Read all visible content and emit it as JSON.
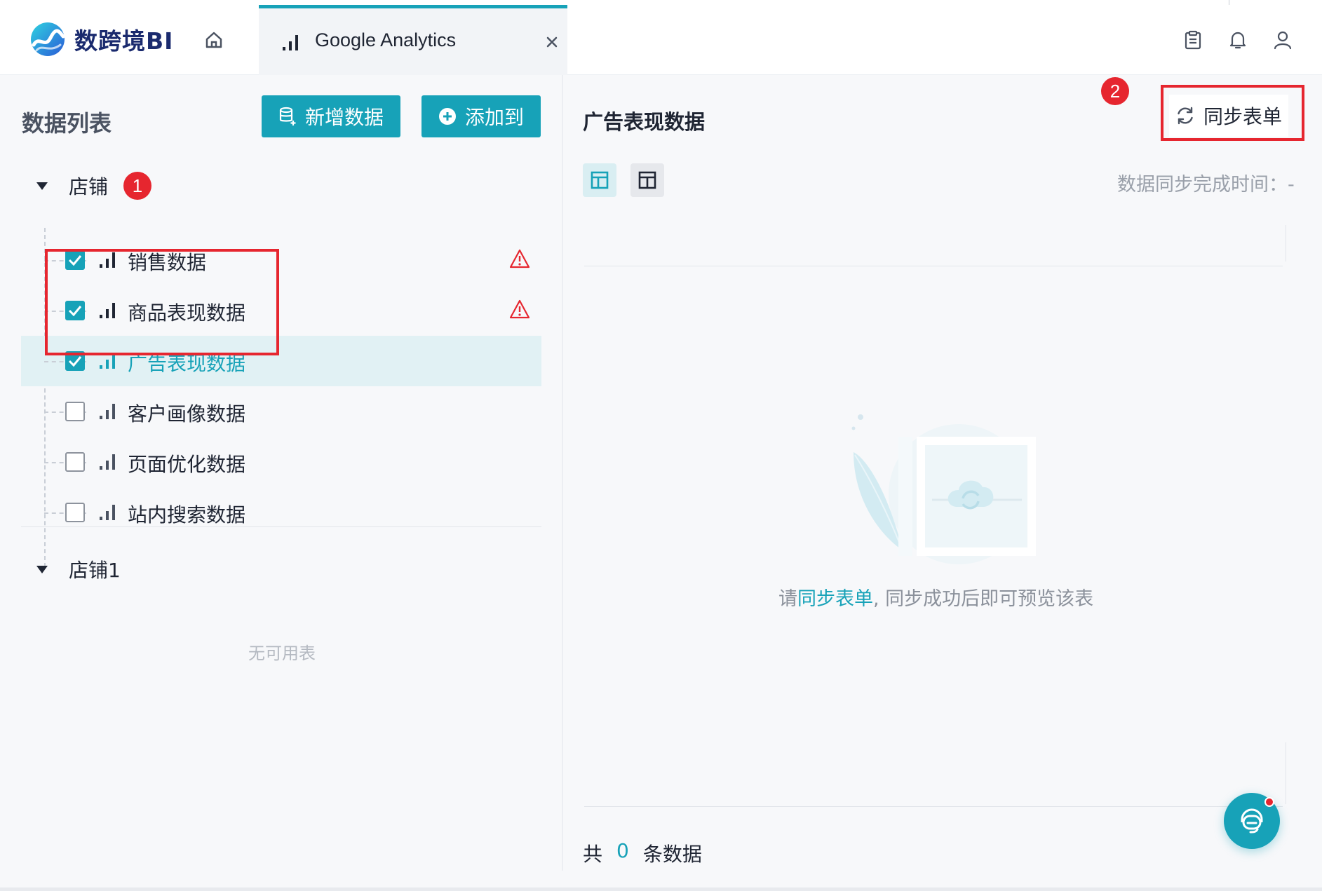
{
  "header": {
    "brand_name": "数跨境BI",
    "tab_title": "Google Analytics",
    "icons": [
      "home-icon",
      "close-icon",
      "clipboard-icon",
      "bell-icon",
      "user-icon"
    ]
  },
  "left": {
    "title": "数据列表",
    "add_data_label": "新增数据",
    "add_to_label": "添加到",
    "groups": [
      {
        "label": "店铺",
        "badge": "1",
        "items": [
          {
            "label": "销售数据",
            "checked": true,
            "warning": true,
            "selected": false
          },
          {
            "label": "商品表现数据",
            "checked": true,
            "warning": true,
            "selected": false
          },
          {
            "label": "广告表现数据",
            "checked": true,
            "warning": false,
            "selected": true
          },
          {
            "label": "客户画像数据",
            "checked": false,
            "warning": false,
            "selected": false
          },
          {
            "label": "页面优化数据",
            "checked": false,
            "warning": false,
            "selected": false
          },
          {
            "label": "站内搜索数据",
            "checked": false,
            "warning": false,
            "selected": false
          }
        ]
      },
      {
        "label": "店铺1",
        "empty_note": "无可用表"
      }
    ]
  },
  "right": {
    "title": "广告表现数据",
    "badge": "2",
    "sync_label": "同步表单",
    "sync_time_label": "数据同步完成时间：-",
    "empty_prefix": "请",
    "empty_link": "同步表单",
    "empty_suffix": ", 同步成功后即可预览该表",
    "footer_prefix": "共",
    "footer_count": "0",
    "footer_suffix": "条数据"
  },
  "colors": {
    "accent": "#17a2b8",
    "alert": "#e6262f",
    "brand": "#1a2a6e"
  }
}
